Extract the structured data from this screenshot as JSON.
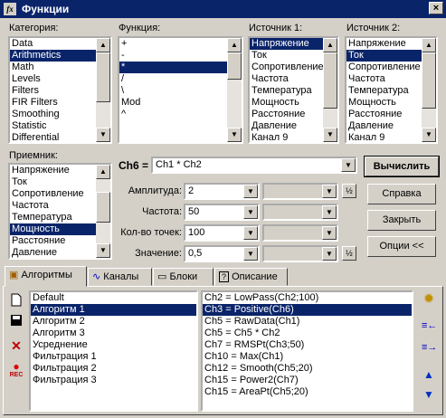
{
  "window": {
    "title": "Функции",
    "close": "×"
  },
  "category": {
    "label": "Категория:",
    "items": [
      "Data",
      "Arithmetics",
      "Math",
      "Levels",
      "Filters",
      "FIR Filters",
      "Smoothing",
      "Statistic",
      "Differential"
    ]
  },
  "function": {
    "label": "Функция:",
    "items": [
      "+",
      "-",
      "*",
      "/",
      "\\",
      "Mod",
      "^"
    ]
  },
  "source1": {
    "label": "Источник 1:",
    "items": [
      "Напряжение",
      "Ток",
      "Сопротивление",
      "Частота",
      "Температура",
      "Мощность",
      "Расстояние",
      "Давление",
      "Канал 9"
    ]
  },
  "source2": {
    "label": "Источник 2:",
    "items": [
      "Напряжение",
      "Ток",
      "Сопротивление",
      "Частота",
      "Температура",
      "Мощность",
      "Расстояние",
      "Давление",
      "Канал 9"
    ]
  },
  "receiver": {
    "label": "Приемник:",
    "items": [
      "Напряжение",
      "Ток",
      "Сопротивление",
      "Частота",
      "Температура",
      "Мощность",
      "Расстояние",
      "Давление"
    ]
  },
  "formula": {
    "label": "Ch6 =",
    "value": "Ch1 * Ch2"
  },
  "params": {
    "amplitude": {
      "label": "Амплитуда:",
      "value": "2"
    },
    "frequency": {
      "label": "Частота:",
      "value": "50"
    },
    "points": {
      "label": "Кол-во точек:",
      "value": "100"
    },
    "value": {
      "label": "Значение:",
      "value": "0,5"
    }
  },
  "buttons": {
    "calculate": "Вычислить",
    "help": "Справка",
    "close": "Закрыть",
    "options": "Опции <<"
  },
  "tabs": [
    "Алгоритмы",
    "Каналы",
    "Блоки",
    "Описание"
  ],
  "algorithms": [
    "Default",
    "Алгоритм 1",
    "Алгоритм 2",
    "Алгоритм 3",
    "Усреднение",
    "Фильтрация 1",
    "Фильтрация 2",
    "Фильтрация 3"
  ],
  "formulas": [
    "Ch2 = LowPass(Ch2;100)",
    "Ch3 = Positive(Ch6)",
    "Ch5 = RawData(Ch1)",
    "Ch5 = Ch5 * Ch2",
    "Ch7 = RMSPt(Ch3;50)",
    "Ch10 = Max(Ch1)",
    "Ch12 = Smooth(Ch5;20)",
    "Ch15 = Power2(Ch7)",
    "Ch15 = AreaPt(Ch5;20)"
  ],
  "misc": {
    "rec": "REC",
    "title_icon": "fx",
    "scale_btn": "½"
  },
  "colors": {
    "selection": "#0a246a",
    "titlebar": "#0a246a",
    "face": "#d4d0c8"
  }
}
